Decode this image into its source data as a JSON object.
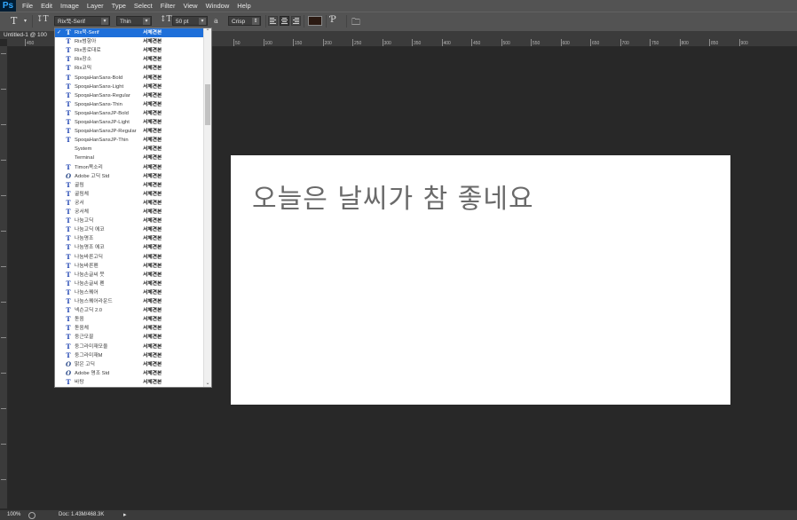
{
  "app": {
    "logo": "Ps"
  },
  "menu": [
    "File",
    "Edit",
    "Image",
    "Layer",
    "Type",
    "Select",
    "Filter",
    "View",
    "Window",
    "Help"
  ],
  "options": {
    "font_family": "Rix묵-Serif",
    "font_style": "Thin",
    "font_size": "50 pt",
    "aa_label": "a",
    "antialias": "Crisp",
    "text_color": "#2b1a12"
  },
  "document": {
    "tab_title": "Untitled-1 @ 100",
    "text": "오늘은 날씨가 참 좋네요"
  },
  "ruler": {
    "h_ticks": [
      "450",
      "50",
      "100",
      "150",
      "200",
      "250",
      "300",
      "350",
      "400",
      "450",
      "500",
      "550",
      "600",
      "650",
      "700",
      "750",
      "800",
      "850",
      "900"
    ],
    "v_ticks": [
      "0",
      "5",
      "10",
      "15",
      "20",
      "25",
      "30",
      "35",
      "40",
      "45",
      "50",
      "55",
      "60"
    ]
  },
  "status": {
    "zoom": "100%",
    "doc": "Doc: 1.43M/468.3K"
  },
  "font_list": [
    {
      "name": "Rix묵-Serif",
      "sample": "서체견본",
      "selected": true,
      "check": "✓"
    },
    {
      "name": "Rix범항아",
      "sample": "서체견본"
    },
    {
      "name": "Rix종로대로",
      "sample": "서체견본"
    },
    {
      "name": "Rix장소",
      "sample": "서체견본"
    },
    {
      "name": "Rix코믹",
      "sample": "서체견본"
    },
    {
      "name": "SpoqaHanSans-Bold",
      "sample": "서체견본"
    },
    {
      "name": "SpoqaHanSans-Light",
      "sample": "서체견본"
    },
    {
      "name": "SpoqaHanSans-Regular",
      "sample": "서체견본"
    },
    {
      "name": "SpoqaHanSans-Thin",
      "sample": "서체견본"
    },
    {
      "name": "SpoqaHanSansJP-Bold",
      "sample": "서체견본"
    },
    {
      "name": "SpoqaHanSansJP-Light",
      "sample": "서체견본"
    },
    {
      "name": "SpoqaHanSansJP-Regular",
      "sample": "서체견본"
    },
    {
      "name": "SpoqaHanSansJP-Thin",
      "sample": "서체견본"
    },
    {
      "name": "System",
      "sample": "서체견본",
      "noicon": true
    },
    {
      "name": "Terminal",
      "sample": "서체견본",
      "noicon": true
    },
    {
      "name": "Timon목소리",
      "sample": "서체견본"
    },
    {
      "name": "Adobe 고딕 Std",
      "sample": "서체견본",
      "otf": true
    },
    {
      "name": "굴림",
      "sample": "서체견본"
    },
    {
      "name": "굴림체",
      "sample": "서체견본"
    },
    {
      "name": "궁서",
      "sample": "서체견본"
    },
    {
      "name": "궁서체",
      "sample": "서체견본"
    },
    {
      "name": "나눔고딕",
      "sample": "서체견본"
    },
    {
      "name": "나눔고딕 에코",
      "sample": "서체견본"
    },
    {
      "name": "나눔명조",
      "sample": "서체견본"
    },
    {
      "name": "나눔명조 에코",
      "sample": "서체견본"
    },
    {
      "name": "나눔바른고딕",
      "sample": "서체견본"
    },
    {
      "name": "나눔바른펜",
      "sample": "서체견본"
    },
    {
      "name": "나눔손글씨 붓",
      "sample": "서체견본"
    },
    {
      "name": "나눔손글씨 펜",
      "sample": "서체견본"
    },
    {
      "name": "나눔스퀘어",
      "sample": "서체견본"
    },
    {
      "name": "나눔스퀘어라운드",
      "sample": "서체견본"
    },
    {
      "name": "넥슨고딕 2.0",
      "sample": "서체견본"
    },
    {
      "name": "돋움",
      "sample": "서체견본"
    },
    {
      "name": "돋움체",
      "sample": "서체견본"
    },
    {
      "name": "둥근모꼴",
      "sample": "서체견본"
    },
    {
      "name": "둥그라미재모울",
      "sample": "서체견본"
    },
    {
      "name": "둥그라미재M",
      "sample": "서체견본"
    },
    {
      "name": "맑은 고딕",
      "sample": "서체견본",
      "otf": true
    },
    {
      "name": "Adobe 명조 Std",
      "sample": "서체견본",
      "otf": true
    },
    {
      "name": "바탕",
      "sample": "서체견본"
    }
  ]
}
